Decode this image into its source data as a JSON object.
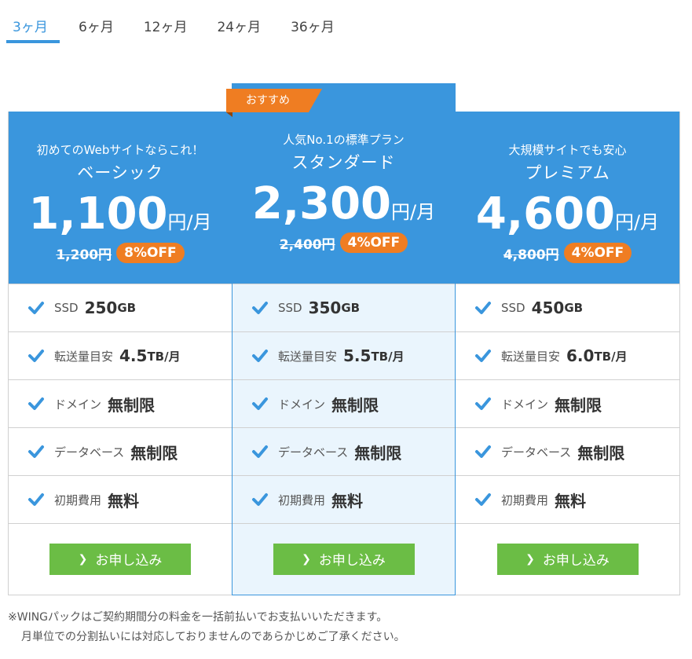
{
  "tabs": [
    "3ヶ月",
    "6ヶ月",
    "12ヶ月",
    "24ヶ月",
    "36ヶ月"
  ],
  "active_tab": "3ヶ月",
  "recommend_label": "おすすめ",
  "plans": [
    {
      "catch": "初めてのWebサイトならこれ！",
      "name": "ベーシック",
      "price": "1,100",
      "unit": "円/月",
      "was": "1,200円",
      "off": "8%OFF",
      "features": [
        {
          "label": "SSD",
          "value": "250",
          "unit": "GB"
        },
        {
          "label": "転送量目安",
          "value": "4.5",
          "unit": "TB/月"
        },
        {
          "label": "ドメイン",
          "value": "無制限",
          "unit": ""
        },
        {
          "label": "データベース",
          "value": "無制限",
          "unit": ""
        },
        {
          "label": "初期費用",
          "value": "無料",
          "unit": ""
        }
      ],
      "apply_label": "お申し込み"
    },
    {
      "catch": "人気No.1の標準プラン",
      "name": "スタンダード",
      "price": "2,300",
      "unit": "円/月",
      "was": "2,400円",
      "off": "4%OFF",
      "features": [
        {
          "label": "SSD",
          "value": "350",
          "unit": "GB"
        },
        {
          "label": "転送量目安",
          "value": "5.5",
          "unit": "TB/月"
        },
        {
          "label": "ドメイン",
          "value": "無制限",
          "unit": ""
        },
        {
          "label": "データベース",
          "value": "無制限",
          "unit": ""
        },
        {
          "label": "初期費用",
          "value": "無料",
          "unit": ""
        }
      ],
      "apply_label": "お申し込み"
    },
    {
      "catch": "大規模サイトでも安心",
      "name": "プレミアム",
      "price": "4,600",
      "unit": "円/月",
      "was": "4,800円",
      "off": "4%OFF",
      "features": [
        {
          "label": "SSD",
          "value": "450",
          "unit": "GB"
        },
        {
          "label": "転送量目安",
          "value": "6.0",
          "unit": "TB/月"
        },
        {
          "label": "ドメイン",
          "value": "無制限",
          "unit": ""
        },
        {
          "label": "データベース",
          "value": "無制限",
          "unit": ""
        },
        {
          "label": "初期費用",
          "value": "無料",
          "unit": ""
        }
      ],
      "apply_label": "お申し込み"
    }
  ],
  "notes": [
    "※WINGパックはご契約期間分の料金を一括前払いでお支払いいただきます。",
    "月単位での分割払いには対応しておりませんのであらかじめご了承ください。"
  ],
  "colors": {
    "accent": "#3a96dd",
    "badge": "#ef7d22",
    "button": "#6bbd45",
    "highlight_bg": "#eaf5fd"
  }
}
